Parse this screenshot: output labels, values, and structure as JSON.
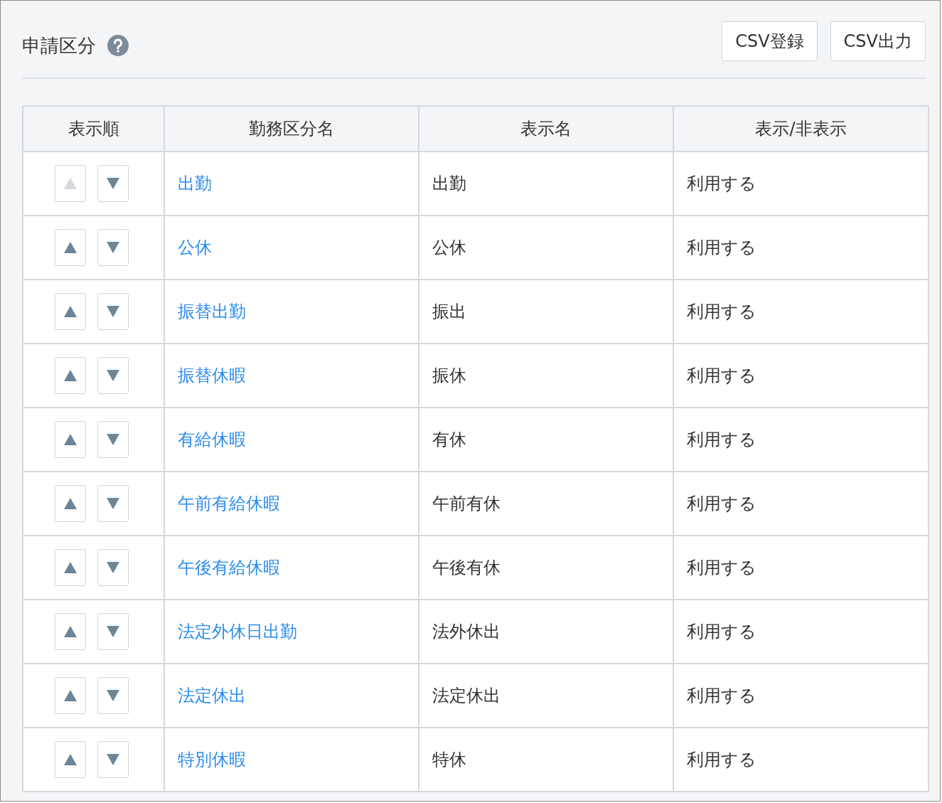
{
  "header": {
    "title": "申請区分",
    "buttons": [
      "CSV登録",
      "CSV出力"
    ]
  },
  "table": {
    "columns": [
      "表示順",
      "勤務区分名",
      "表示名",
      "表示/非表示"
    ],
    "rows": [
      {
        "up_disabled": true,
        "down_disabled": false,
        "name": "出勤",
        "display_name": "出勤",
        "visibility": "利用する"
      },
      {
        "up_disabled": false,
        "down_disabled": false,
        "name": "公休",
        "display_name": "公休",
        "visibility": "利用する"
      },
      {
        "up_disabled": false,
        "down_disabled": false,
        "name": "振替出勤",
        "display_name": "振出",
        "visibility": "利用する"
      },
      {
        "up_disabled": false,
        "down_disabled": false,
        "name": "振替休暇",
        "display_name": "振休",
        "visibility": "利用する"
      },
      {
        "up_disabled": false,
        "down_disabled": false,
        "name": "有給休暇",
        "display_name": "有休",
        "visibility": "利用する"
      },
      {
        "up_disabled": false,
        "down_disabled": false,
        "name": "午前有給休暇",
        "display_name": "午前有休",
        "visibility": "利用する"
      },
      {
        "up_disabled": false,
        "down_disabled": false,
        "name": "午後有給休暇",
        "display_name": "午後有休",
        "visibility": "利用する"
      },
      {
        "up_disabled": false,
        "down_disabled": false,
        "name": "法定外休日出勤",
        "display_name": "法外休出",
        "visibility": "利用する"
      },
      {
        "up_disabled": false,
        "down_disabled": false,
        "name": "法定休出",
        "display_name": "法定休出",
        "visibility": "利用する"
      },
      {
        "up_disabled": false,
        "down_disabled": false,
        "name": "特別休暇",
        "display_name": "特休",
        "visibility": "利用する"
      }
    ]
  }
}
